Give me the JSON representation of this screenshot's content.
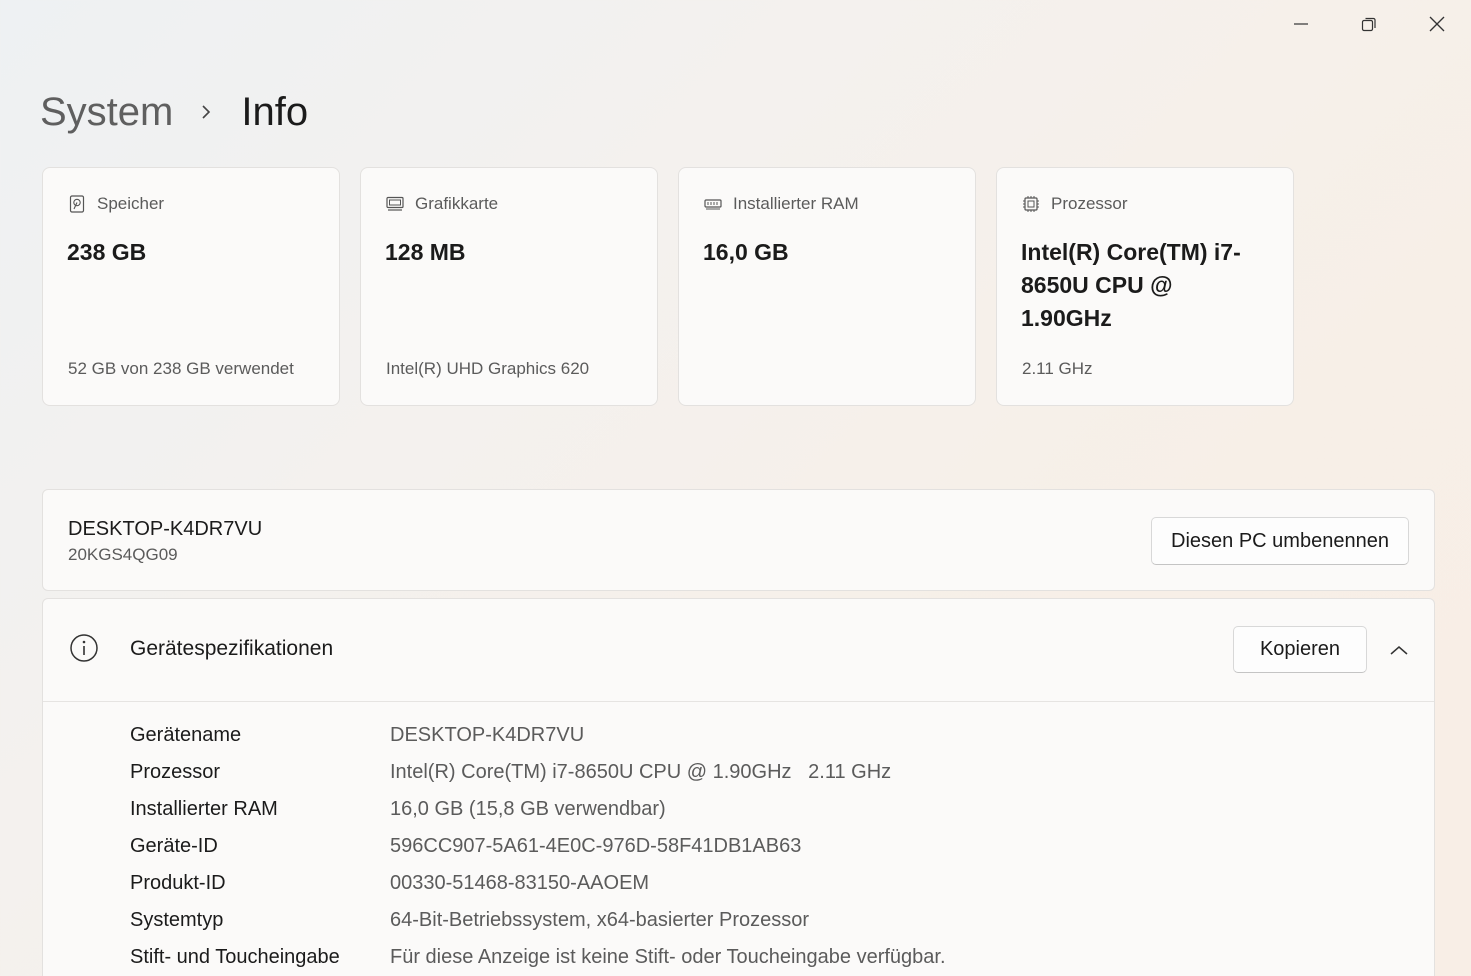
{
  "window": {
    "minimize_icon": "minimize-icon",
    "restore_icon": "restore-icon",
    "close_icon": "close-icon"
  },
  "breadcrumb": {
    "parent": "System",
    "current": "Info"
  },
  "cards": [
    {
      "icon": "storage-icon",
      "title": "Speicher",
      "value": "238 GB",
      "sub": "52 GB von 238 GB verwendet"
    },
    {
      "icon": "graphics-card-icon",
      "title": "Grafikkarte",
      "value": "128 MB",
      "sub": "Intel(R) UHD Graphics 620"
    },
    {
      "icon": "ram-icon",
      "title": "Installierter RAM",
      "value": "16,0 GB",
      "sub": ""
    },
    {
      "icon": "processor-icon",
      "title": "Prozessor",
      "value": "Intel(R) Core(TM) i7-8650U CPU @ 1.90GHz",
      "sub": "2.11 GHz"
    }
  ],
  "device": {
    "name": "DESKTOP-K4DR7VU",
    "model": "20KGS4QG09",
    "rename_label": "Diesen PC umbenennen"
  },
  "specs": {
    "title": "Gerätespezifikationen",
    "copy_label": "Kopieren",
    "rows": [
      {
        "label": "Gerätename",
        "value": "DESKTOP-K4DR7VU"
      },
      {
        "label": "Prozessor",
        "value": "Intel(R) Core(TM) i7-8650U CPU @ 1.90GHz   2.11 GHz"
      },
      {
        "label": "Installierter RAM",
        "value": "16,0 GB (15,8 GB verwendbar)"
      },
      {
        "label": "Geräte-ID",
        "value": "596CC907-5A61-4E0C-976D-58F41DB1AB63"
      },
      {
        "label": "Produkt-ID",
        "value": "00330-51468-83150-AAOEM"
      },
      {
        "label": "Systemtyp",
        "value": "64-Bit-Betriebssystem, x64-basierter Prozessor"
      },
      {
        "label": "Stift- und Toucheingabe",
        "value": "Für diese Anzeige ist keine Stift- oder Toucheingabe verfügbar."
      }
    ]
  }
}
